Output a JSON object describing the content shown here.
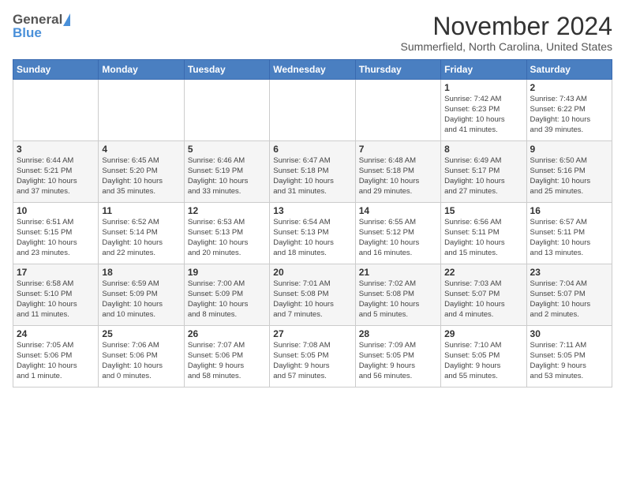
{
  "header": {
    "logo_general": "General",
    "logo_blue": "Blue",
    "month_title": "November 2024",
    "location": "Summerfield, North Carolina, United States"
  },
  "weekdays": [
    "Sunday",
    "Monday",
    "Tuesday",
    "Wednesday",
    "Thursday",
    "Friday",
    "Saturday"
  ],
  "weeks": [
    [
      {
        "day": "",
        "info": ""
      },
      {
        "day": "",
        "info": ""
      },
      {
        "day": "",
        "info": ""
      },
      {
        "day": "",
        "info": ""
      },
      {
        "day": "",
        "info": ""
      },
      {
        "day": "1",
        "info": "Sunrise: 7:42 AM\nSunset: 6:23 PM\nDaylight: 10 hours\nand 41 minutes."
      },
      {
        "day": "2",
        "info": "Sunrise: 7:43 AM\nSunset: 6:22 PM\nDaylight: 10 hours\nand 39 minutes."
      }
    ],
    [
      {
        "day": "3",
        "info": "Sunrise: 6:44 AM\nSunset: 5:21 PM\nDaylight: 10 hours\nand 37 minutes."
      },
      {
        "day": "4",
        "info": "Sunrise: 6:45 AM\nSunset: 5:20 PM\nDaylight: 10 hours\nand 35 minutes."
      },
      {
        "day": "5",
        "info": "Sunrise: 6:46 AM\nSunset: 5:19 PM\nDaylight: 10 hours\nand 33 minutes."
      },
      {
        "day": "6",
        "info": "Sunrise: 6:47 AM\nSunset: 5:18 PM\nDaylight: 10 hours\nand 31 minutes."
      },
      {
        "day": "7",
        "info": "Sunrise: 6:48 AM\nSunset: 5:18 PM\nDaylight: 10 hours\nand 29 minutes."
      },
      {
        "day": "8",
        "info": "Sunrise: 6:49 AM\nSunset: 5:17 PM\nDaylight: 10 hours\nand 27 minutes."
      },
      {
        "day": "9",
        "info": "Sunrise: 6:50 AM\nSunset: 5:16 PM\nDaylight: 10 hours\nand 25 minutes."
      }
    ],
    [
      {
        "day": "10",
        "info": "Sunrise: 6:51 AM\nSunset: 5:15 PM\nDaylight: 10 hours\nand 23 minutes."
      },
      {
        "day": "11",
        "info": "Sunrise: 6:52 AM\nSunset: 5:14 PM\nDaylight: 10 hours\nand 22 minutes."
      },
      {
        "day": "12",
        "info": "Sunrise: 6:53 AM\nSunset: 5:13 PM\nDaylight: 10 hours\nand 20 minutes."
      },
      {
        "day": "13",
        "info": "Sunrise: 6:54 AM\nSunset: 5:13 PM\nDaylight: 10 hours\nand 18 minutes."
      },
      {
        "day": "14",
        "info": "Sunrise: 6:55 AM\nSunset: 5:12 PM\nDaylight: 10 hours\nand 16 minutes."
      },
      {
        "day": "15",
        "info": "Sunrise: 6:56 AM\nSunset: 5:11 PM\nDaylight: 10 hours\nand 15 minutes."
      },
      {
        "day": "16",
        "info": "Sunrise: 6:57 AM\nSunset: 5:11 PM\nDaylight: 10 hours\nand 13 minutes."
      }
    ],
    [
      {
        "day": "17",
        "info": "Sunrise: 6:58 AM\nSunset: 5:10 PM\nDaylight: 10 hours\nand 11 minutes."
      },
      {
        "day": "18",
        "info": "Sunrise: 6:59 AM\nSunset: 5:09 PM\nDaylight: 10 hours\nand 10 minutes."
      },
      {
        "day": "19",
        "info": "Sunrise: 7:00 AM\nSunset: 5:09 PM\nDaylight: 10 hours\nand 8 minutes."
      },
      {
        "day": "20",
        "info": "Sunrise: 7:01 AM\nSunset: 5:08 PM\nDaylight: 10 hours\nand 7 minutes."
      },
      {
        "day": "21",
        "info": "Sunrise: 7:02 AM\nSunset: 5:08 PM\nDaylight: 10 hours\nand 5 minutes."
      },
      {
        "day": "22",
        "info": "Sunrise: 7:03 AM\nSunset: 5:07 PM\nDaylight: 10 hours\nand 4 minutes."
      },
      {
        "day": "23",
        "info": "Sunrise: 7:04 AM\nSunset: 5:07 PM\nDaylight: 10 hours\nand 2 minutes."
      }
    ],
    [
      {
        "day": "24",
        "info": "Sunrise: 7:05 AM\nSunset: 5:06 PM\nDaylight: 10 hours\nand 1 minute."
      },
      {
        "day": "25",
        "info": "Sunrise: 7:06 AM\nSunset: 5:06 PM\nDaylight: 10 hours\nand 0 minutes."
      },
      {
        "day": "26",
        "info": "Sunrise: 7:07 AM\nSunset: 5:06 PM\nDaylight: 9 hours\nand 58 minutes."
      },
      {
        "day": "27",
        "info": "Sunrise: 7:08 AM\nSunset: 5:05 PM\nDaylight: 9 hours\nand 57 minutes."
      },
      {
        "day": "28",
        "info": "Sunrise: 7:09 AM\nSunset: 5:05 PM\nDaylight: 9 hours\nand 56 minutes."
      },
      {
        "day": "29",
        "info": "Sunrise: 7:10 AM\nSunset: 5:05 PM\nDaylight: 9 hours\nand 55 minutes."
      },
      {
        "day": "30",
        "info": "Sunrise: 7:11 AM\nSunset: 5:05 PM\nDaylight: 9 hours\nand 53 minutes."
      }
    ]
  ]
}
